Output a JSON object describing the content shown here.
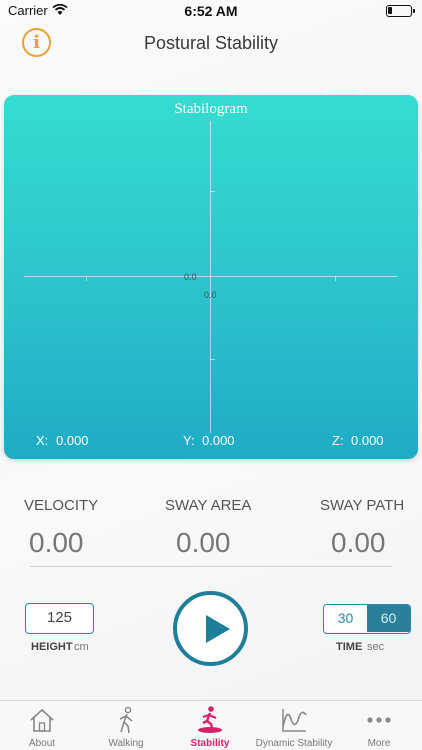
{
  "status_bar": {
    "carrier": "Carrier",
    "time": "6:52 AM",
    "battery_level": 0.2
  },
  "nav": {
    "info_icon_text": "i",
    "title": "Postural Stability"
  },
  "stabilogram": {
    "title": "Stabilogram",
    "origin_x_label": "0.0",
    "origin_y_label": "0.0",
    "readouts": {
      "x_label": "X:",
      "x_value": "0.000",
      "y_label": "Y:",
      "y_value": "0.000",
      "z_label": "Z:",
      "z_value": "0.000"
    }
  },
  "metrics": {
    "velocity_label": "VELOCITY",
    "velocity_value": "0.00",
    "sway_area_label": "SWAY AREA",
    "sway_area_value": "0.00",
    "sway_path_label": "SWAY PATH",
    "sway_path_value": "0.00"
  },
  "controls": {
    "height_value": "125",
    "height_label": "HEIGHT",
    "height_unit": "cm",
    "time_options": [
      "30",
      "60"
    ],
    "time_selected": "60",
    "time_label": "TIME",
    "time_unit": "sec"
  },
  "tabs": [
    {
      "label": "About",
      "icon": "house-icon"
    },
    {
      "label": "Walking",
      "icon": "walking-icon"
    },
    {
      "label": "Stability",
      "icon": "balance-board-icon",
      "active": true
    },
    {
      "label": "Dynamic Stability",
      "icon": "wave-icon"
    },
    {
      "label": "More",
      "icon": "more-dots-icon"
    }
  ],
  "colors": {
    "accent": "#1f7e99",
    "active_tab": "#d6226d",
    "info": "#f0a030",
    "panel_top": "#35dcd0",
    "panel_bottom": "#1fabc6"
  }
}
